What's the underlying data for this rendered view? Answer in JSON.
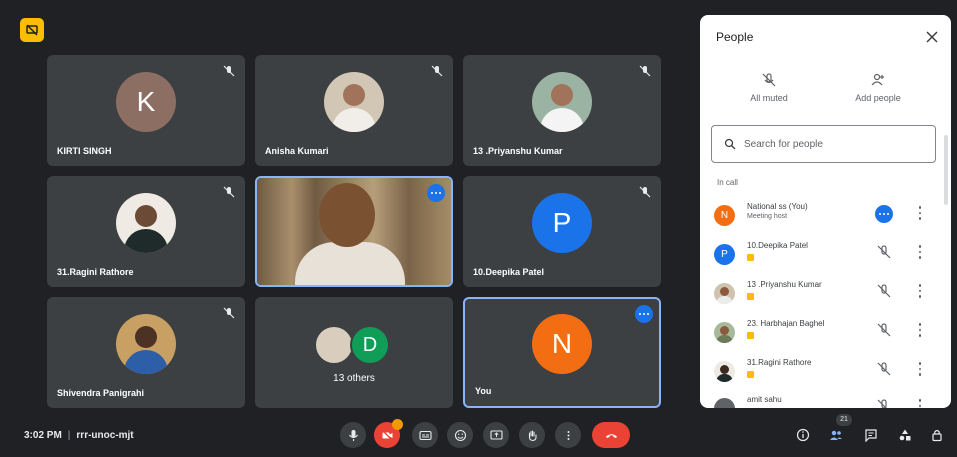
{
  "tiles": [
    {
      "name": "KIRTI SINGH",
      "initial": "K",
      "color": "#8d6e63"
    },
    {
      "name": "Anisha Kumari"
    },
    {
      "name": "13 .Priyanshu Kumar"
    },
    {
      "name": "31.Ragini Rathore"
    },
    {
      "name": ""
    },
    {
      "name": "10.Deepika Patel",
      "initial": "P",
      "color": "#1a73e8"
    },
    {
      "name": "Shivendra Panigrahi"
    },
    {
      "others_initial": "D",
      "others_label": "13 others"
    },
    {
      "name": "You",
      "initial": "N",
      "color": "#f36e12"
    }
  ],
  "panel": {
    "title": "People",
    "all_muted": "All muted",
    "add_people": "Add people",
    "search_placeholder": "Search for people",
    "section": "In call",
    "people": [
      {
        "name": "National ss (You)",
        "sub": "Meeting host",
        "initial": "N",
        "color": "#f36e12"
      },
      {
        "name": "10.Deepika Patel",
        "initial": "P",
        "color": "#1a73e8"
      },
      {
        "name": "13 .Priyanshu Kumar"
      },
      {
        "name": "23. Harbhajan Baghel"
      },
      {
        "name": "31.Ragini Rathore"
      },
      {
        "name": "amit sahu"
      }
    ]
  },
  "bottom": {
    "time": "3:02 PM",
    "meeting_code": "rrr-unoc-mjt",
    "participants_count": "21"
  },
  "icons": {
    "app": "meet-presenting-icon",
    "tile_mute": "mic-off-icon",
    "controls": [
      "mic-icon",
      "camera-off-icon",
      "captions-icon",
      "emoji-icon",
      "present-icon",
      "raise-hand-icon",
      "more-options-icon",
      "end-call-icon"
    ],
    "right": [
      "info-icon",
      "people-icon",
      "chat-icon",
      "activities-icon",
      "host-controls-icon"
    ]
  },
  "colors": {
    "background": "#202124",
    "tile": "#3c4043",
    "accent_blue": "#1a73e8",
    "end_call_red": "#ea4335",
    "app_badge": "#fbbc04"
  }
}
